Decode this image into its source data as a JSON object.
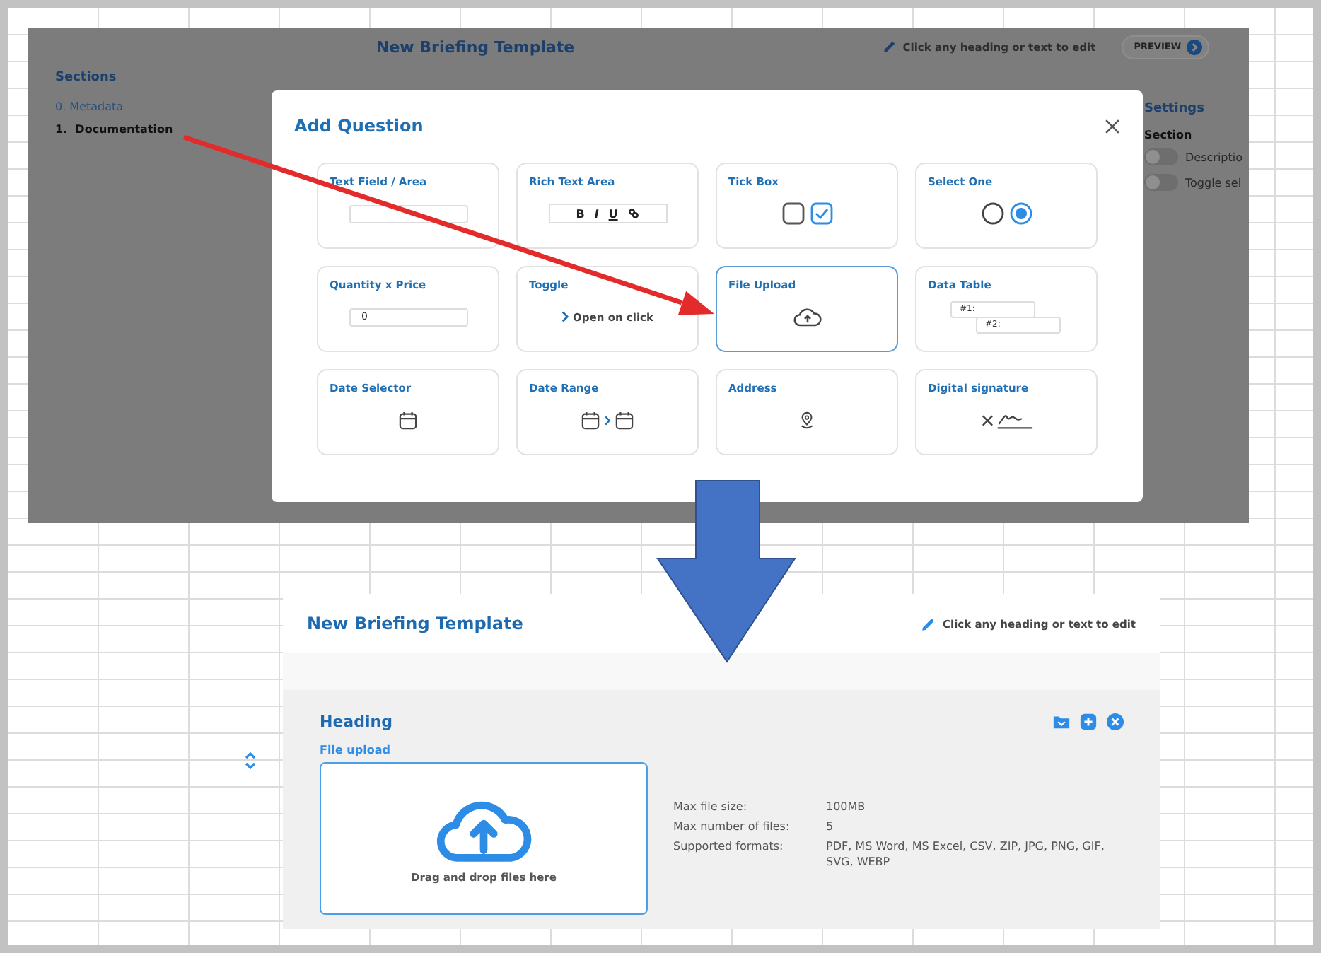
{
  "top_screenshot": {
    "title": "New Briefing Template",
    "edit_hint": "Click any heading or text to edit",
    "preview_button": "PREVIEW",
    "sidebar": {
      "heading": "Sections",
      "items": [
        {
          "label": "0. Metadata",
          "selected": false
        },
        {
          "label": "1.  Documentation",
          "selected": true
        }
      ]
    },
    "settings_panel": {
      "heading": "Settings",
      "subheading": "Section",
      "toggles": [
        {
          "label": "Descriptio",
          "on": false
        },
        {
          "label": "Toggle sel",
          "on": false
        }
      ]
    },
    "modal": {
      "title": "Add Question",
      "options": [
        {
          "label": "Text Field / Area",
          "kind": "text_field",
          "selected": false
        },
        {
          "label": "Rich Text Area",
          "kind": "rich_text",
          "selected": false,
          "format_buttons": [
            {
              "label": "B",
              "kind": "bold"
            },
            {
              "label": "I",
              "kind": "italic"
            },
            {
              "label": "U",
              "kind": "underline"
            }
          ]
        },
        {
          "label": "Tick Box",
          "kind": "tick_box",
          "selected": false,
          "checkboxes": [
            {
              "checked": false
            },
            {
              "checked": true
            }
          ]
        },
        {
          "label": "Select One",
          "kind": "select_one",
          "selected": false,
          "radios": [
            {
              "selected": false
            },
            {
              "selected": true
            }
          ]
        },
        {
          "label": "Quantity x Price",
          "kind": "quantity",
          "selected": false,
          "value": "0"
        },
        {
          "label": "Toggle",
          "kind": "toggle",
          "selected": false,
          "text": "Open on click"
        },
        {
          "label": "File Upload",
          "kind": "file_upload",
          "selected": true
        },
        {
          "label": "Data Table",
          "kind": "data_table",
          "selected": false,
          "fields": [
            "#1:",
            "#2:"
          ]
        },
        {
          "label": "Date Selector",
          "kind": "date",
          "selected": false
        },
        {
          "label": "Date Range",
          "kind": "date_range",
          "selected": false
        },
        {
          "label": "Address",
          "kind": "address",
          "selected": false
        },
        {
          "label": "Digital signature",
          "kind": "signature",
          "selected": false
        }
      ]
    }
  },
  "bottom_screenshot": {
    "title": "New Briefing Template",
    "edit_hint": "Click any heading or text to edit",
    "question": {
      "heading": "Heading",
      "label": "File upload",
      "dropzone_text": "Drag and drop files here",
      "details": [
        {
          "label": "Max file size:",
          "value": "100MB"
        },
        {
          "label": "Max number of files:",
          "value": "5"
        },
        {
          "label": "Supported formats:",
          "value": "PDF, MS Word, MS Excel, CSV, ZIP, JPG, PNG, GIF, SVG, WEBP"
        }
      ]
    }
  }
}
